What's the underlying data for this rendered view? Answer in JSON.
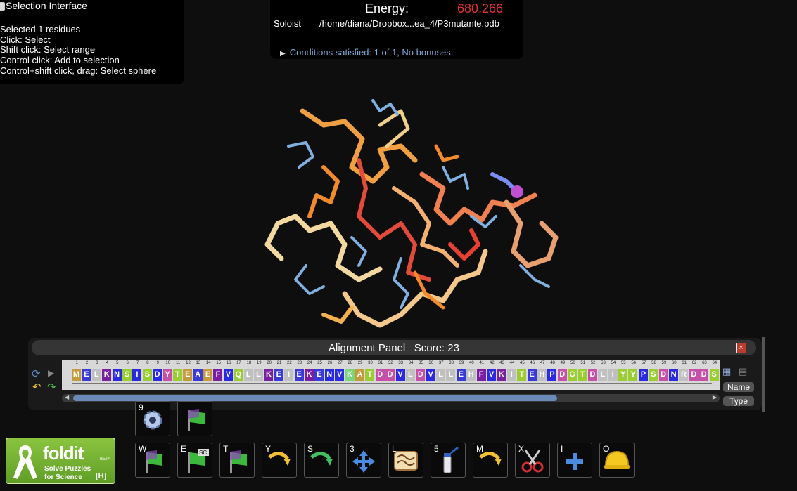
{
  "selection": {
    "title": "Selection Interface",
    "lines": [
      "Selected 1 residues",
      "Click: Select",
      "Shift click: Select range",
      "Control click: Add to selection",
      "Control+shift click, drag: Select sphere"
    ]
  },
  "energy": {
    "label": "Energy:",
    "value": "680.266",
    "value_color": "#e83232",
    "mode": "Soloist",
    "file": "/home/diana/Dropbox...ea_4/P3mutante.pdb",
    "conditions": "Conditions satisfied: 1 of 1, No bonuses."
  },
  "alignment": {
    "title": "Alignment Panel",
    "score_label": "Score: 23",
    "sequence": "MELKNSISDYTEAEFVQLLKEIEKENVKATDDVLDVLLEHFVKITEHPDGTDLIYYPSDNRDDSPE",
    "colors": [
      "#c49a3a",
      "#3a3ad6",
      "#c0c0c0",
      "#7b1fa2",
      "#2a2ae0",
      "#9acd32",
      "#2a2ae0",
      "#9acd32",
      "#2a2ae0",
      "#c64fa8",
      "#9acd32",
      "#c49a3a",
      "#3a3ad6",
      "#c49a3a",
      "#7b1fa2",
      "#2a2ae0",
      "#9acd32",
      "#c0c0c0",
      "#c0c0c0",
      "#7b1fa2",
      "#3a3ad6",
      "#c0c0c0",
      "#3a3ad6",
      "#7b1fa2",
      "#3a3ad6",
      "#2a2ae0",
      "#2a2ae0",
      "#7bd67b",
      "#c49a3a",
      "#9acd32",
      "#c64fa8",
      "#c64fa8",
      "#2a2ae0",
      "#c0c0c0",
      "#c64fa8",
      "#2a2ae0",
      "#c0c0c0",
      "#c0c0c0",
      "#3a3ad6",
      "#c0c0c0",
      "#7b1fa2",
      "#2a2ae0",
      "#7b1fa2",
      "#c0c0c0",
      "#9acd32",
      "#3a3ad6",
      "#c0c0c0",
      "#2a2ae0",
      "#c64fa8",
      "#9acd32",
      "#9acd32",
      "#c64fa8",
      "#c0c0c0",
      "#c0c0c0",
      "#9acd32",
      "#9acd32",
      "#2a2ae0",
      "#9acd32",
      "#c64fa8",
      "#2a2ae0",
      "#c0c0c0",
      "#c64fa8",
      "#c64fa8",
      "#9acd32",
      "#2a2ae0",
      "#3a3ad6"
    ],
    "name_button": "Name",
    "type_button": "Type"
  },
  "toolbar": {
    "upper": [
      {
        "key": "9",
        "icon": "gear-icon"
      },
      {
        "key": "",
        "icon": "flag-icon"
      }
    ],
    "lower": [
      {
        "key": "W",
        "icon": "flag-icon"
      },
      {
        "key": "E",
        "icon": "flag-sc-icon"
      },
      {
        "key": "T",
        "icon": "flag-icon"
      },
      {
        "key": "Y",
        "icon": "curved-arrow-icon"
      },
      {
        "key": "S",
        "icon": "curved-arrow-green-icon"
      },
      {
        "key": "3",
        "icon": "move-icon"
      },
      {
        "key": "L",
        "icon": "rubber-band-icon"
      },
      {
        "key": "5",
        "icon": "tube-icon"
      },
      {
        "key": "M",
        "icon": "curved-arrow-icon"
      },
      {
        "key": "X",
        "icon": "scissors-icon"
      },
      {
        "key": "I",
        "icon": "plus-icon"
      },
      {
        "key": "O",
        "icon": "helmet-icon"
      }
    ]
  },
  "logo": {
    "name": "foldit",
    "beta": "BETA",
    "tag1": "Solve Puzzles",
    "tag2": "for Science",
    "help": "[H]"
  }
}
